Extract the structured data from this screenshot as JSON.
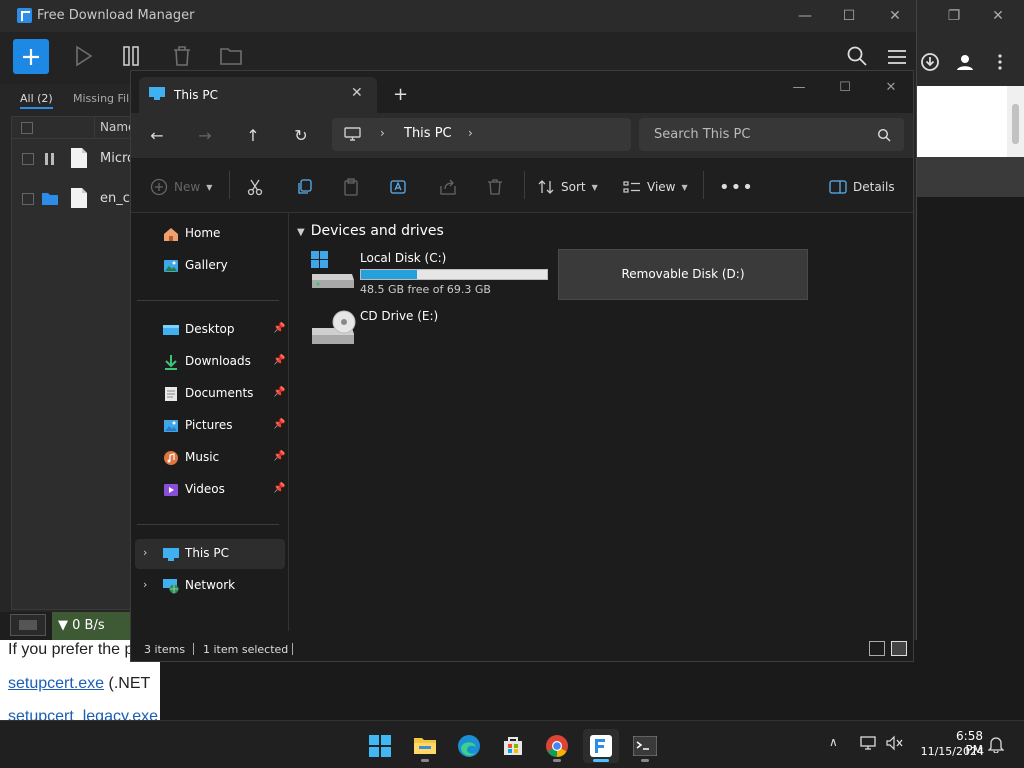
{
  "fdm": {
    "title": "Free Download Manager",
    "filters": {
      "all": "All (2)",
      "missing": "Missing Fil"
    },
    "list": {
      "column_name": "Name",
      "rows": [
        {
          "name": "Micro"
        },
        {
          "name": "en_c"
        }
      ]
    },
    "speed": "▼ 0 B/s"
  },
  "webpage": {
    "line1": "If you prefer the p",
    "line2_link": "setupcert.exe",
    "line2_rest": " (.NET ",
    "line3_link": "setupcert_legacy.exe"
  },
  "explorer": {
    "tab_title": "This PC",
    "address": "This PC",
    "search_placeholder": "Search This PC",
    "commands": {
      "new": "New",
      "sort": "Sort",
      "view": "View",
      "details": "Details"
    },
    "sidebar": {
      "top": [
        {
          "label": "Home"
        },
        {
          "label": "Gallery"
        }
      ],
      "pinned": [
        {
          "label": "Desktop"
        },
        {
          "label": "Downloads"
        },
        {
          "label": "Documents"
        },
        {
          "label": "Pictures"
        },
        {
          "label": "Music"
        },
        {
          "label": "Videos"
        }
      ],
      "roots": [
        {
          "label": "This PC"
        },
        {
          "label": "Network"
        }
      ]
    },
    "group_title": "Devices and drives",
    "drives": {
      "c": {
        "name": "Local Disk (C:)",
        "info": "48.5 GB free of 69.3 GB",
        "used_fraction": 0.3
      },
      "d": {
        "name": "Removable Disk (D:)"
      },
      "e": {
        "name": "CD Drive (E:)"
      }
    },
    "status": {
      "count": "3 items",
      "selected": "1 item selected"
    }
  },
  "taskbar": {
    "time": "6:58 PM",
    "date": "11/15/2024"
  },
  "colors": {
    "accent": "#1e88e5",
    "drive_bar": "#26a0da",
    "speed_bg": "#3e5a34"
  }
}
